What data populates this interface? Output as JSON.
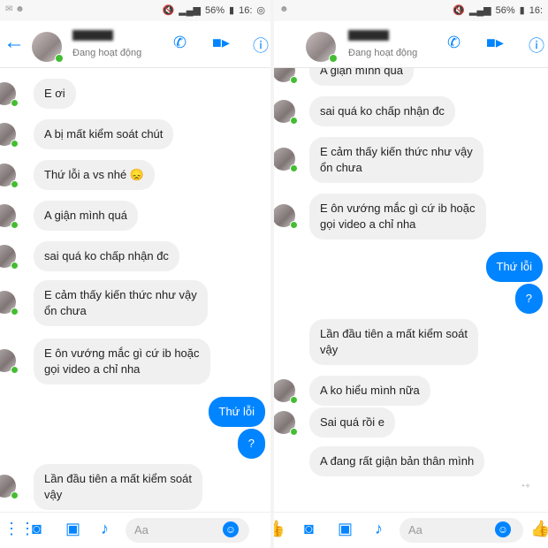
{
  "statusbar": {
    "battery_pct": "56%",
    "time": "16:"
  },
  "header": {
    "status": "Đang hoạt động"
  },
  "composer": {
    "placeholder": "Aa"
  },
  "left": {
    "messages": [
      {
        "text": "E ơi",
        "out": false
      },
      {
        "text": "A bị mất kiểm soát chút",
        "out": false
      },
      {
        "text": "Thứ lỗi a vs nhé 😞",
        "out": false
      },
      {
        "text": "A giận mình quá",
        "out": false
      },
      {
        "text": "sai quá ko chấp nhận đc",
        "out": false
      },
      {
        "text": "E cảm thấy kiến thức như vậy\nổn chưa",
        "out": false
      },
      {
        "text": "E ôn vướng mắc gì cứ ib hoặc\ngọi video a chỉ nha",
        "out": false
      },
      {
        "text": "Thứ lỗi",
        "out": true
      },
      {
        "text": "?",
        "out": true
      },
      {
        "text": "Lần đầu tiên a mất kiểm soát\nvậy",
        "out": false
      }
    ]
  },
  "right": {
    "messages": [
      {
        "text": "A giận mình quá",
        "out": false
      },
      {
        "text": "sai quá ko chấp nhận đc",
        "out": false
      },
      {
        "text": "E cảm thấy kiến thức như vậy\nổn chưa",
        "out": false
      },
      {
        "text": "E ôn vướng mắc gì cứ ib hoặc\ngọi video a chỉ nha",
        "out": false
      },
      {
        "text": "Thứ lỗi",
        "out": true
      },
      {
        "text": "?",
        "out": true
      },
      {
        "text": "Lần đầu tiên a mất kiểm soát\nvậy",
        "out": false
      },
      {
        "text": "A ko hiểu mình nữa",
        "out": false
      },
      {
        "text": "Sai quá rồi e",
        "out": false
      },
      {
        "text": "A đang rất giận bản thân mình",
        "out": false
      }
    ]
  }
}
